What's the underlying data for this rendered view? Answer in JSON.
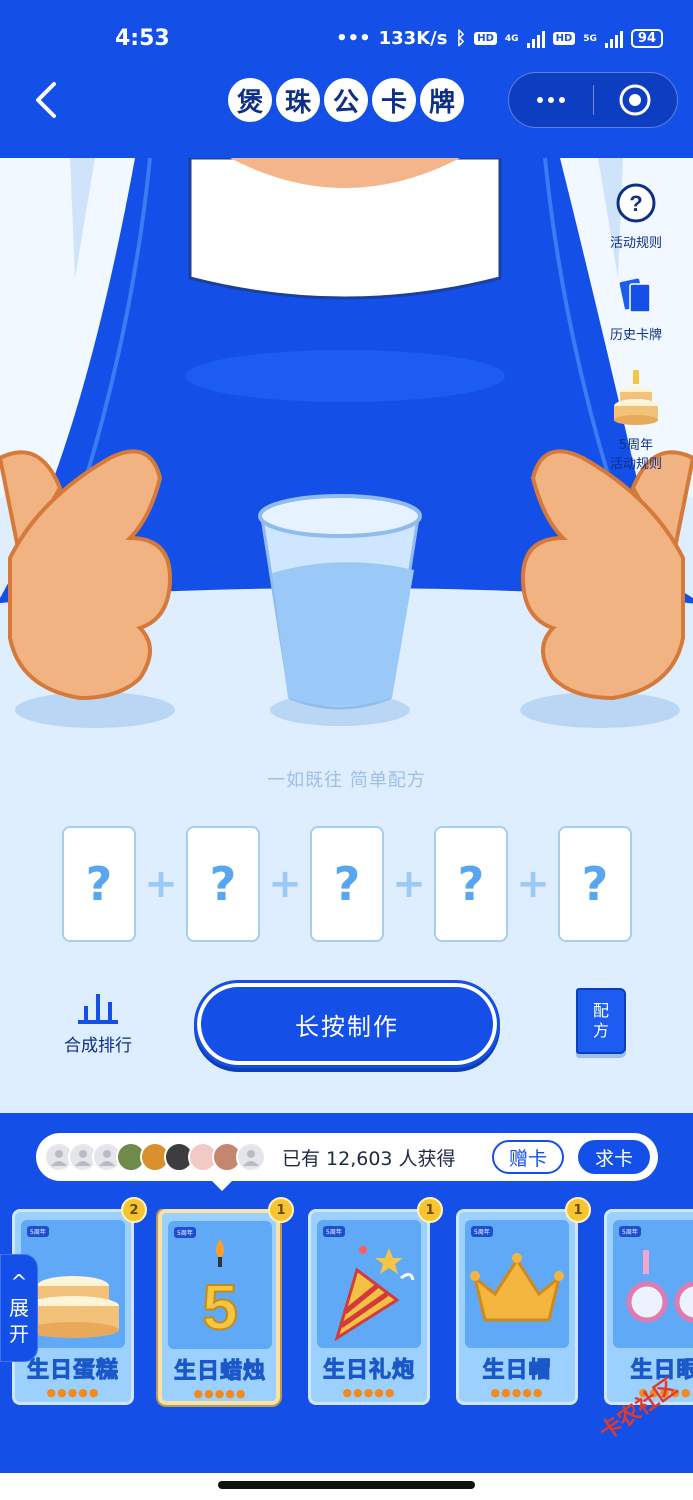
{
  "status_bar": {
    "time": "4:53",
    "network_speed": "133K/s",
    "hd_label": "HD",
    "net_4g": "4G",
    "net_5g": "5G",
    "battery": "94"
  },
  "header": {
    "title_chars": [
      "煲",
      "珠",
      "公",
      "卡",
      "牌"
    ]
  },
  "side_menu": {
    "rules_label": "活动规则",
    "history_label": "历史卡牌",
    "anniversary_line1": "5周年",
    "anniversary_line2": "活动规则"
  },
  "scene": {
    "slogan": "一如既往 简单配方",
    "slot_symbol": "?",
    "plus_symbol": "+"
  },
  "actions": {
    "rank_label": "合成排行",
    "make_label": "长按制作",
    "recipe_line1": "配",
    "recipe_line2": "方"
  },
  "owners": {
    "text": "已有 12,603 人获得",
    "gift_label": "赠卡",
    "ask_label": "求卡"
  },
  "cards": [
    {
      "name": "生日蛋糕",
      "count": "2",
      "tag": "5周年",
      "drops": "●●●●●"
    },
    {
      "name": "生日蜡烛",
      "count": "1",
      "tag": "5周年",
      "drops": "●●●●●",
      "candle_number": "5"
    },
    {
      "name": "生日礼炮",
      "count": "1",
      "tag": "5周年",
      "drops": "●●●●●"
    },
    {
      "name": "生日帽",
      "count": "1",
      "tag": "5周年",
      "drops": "●●●●●"
    },
    {
      "name": "生日眼",
      "count": "",
      "tag": "5周年",
      "drops": "●●●●●"
    }
  ],
  "expand": {
    "arrow": "^",
    "line1": "展",
    "line2": "开"
  },
  "watermark": "卡农社区",
  "colors": {
    "brand_blue": "#1450e8",
    "scene_bg": "#deeeff",
    "badge_gold": "#f7c531"
  }
}
